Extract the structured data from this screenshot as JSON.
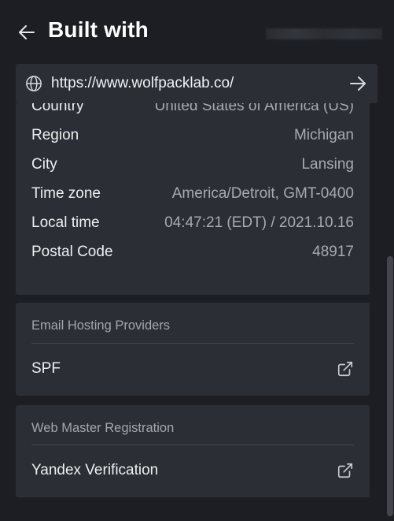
{
  "header": {
    "title": "Built with",
    "back_icon": "arrow-left-icon"
  },
  "urlbar": {
    "url": "https://www.wolfpacklab.co/",
    "globe_icon": "globe-icon",
    "go_icon": "arrow-right-icon"
  },
  "geo": {
    "rows": [
      {
        "key": "Country",
        "value": "United States of America (US)"
      },
      {
        "key": "Region",
        "value": "Michigan"
      },
      {
        "key": "City",
        "value": "Lansing"
      },
      {
        "key": "Time zone",
        "value": "America/Detroit, GMT-0400"
      },
      {
        "key": "Local time",
        "value": "04:47:21 (EDT) / 2021.10.16"
      },
      {
        "key": "Postal Code",
        "value": "48917"
      }
    ]
  },
  "email_hosting": {
    "title": "Email Hosting Providers",
    "items": [
      {
        "label": "SPF",
        "icon": "external-link-icon"
      }
    ]
  },
  "webmaster": {
    "title": "Web Master Registration",
    "items": [
      {
        "label": "Yandex Verification",
        "icon": "external-link-icon"
      }
    ]
  },
  "colors": {
    "background": "#1c1e23",
    "card": "#2b2e34",
    "text_primary": "#eeeff2",
    "text_secondary": "#a7aab1"
  }
}
